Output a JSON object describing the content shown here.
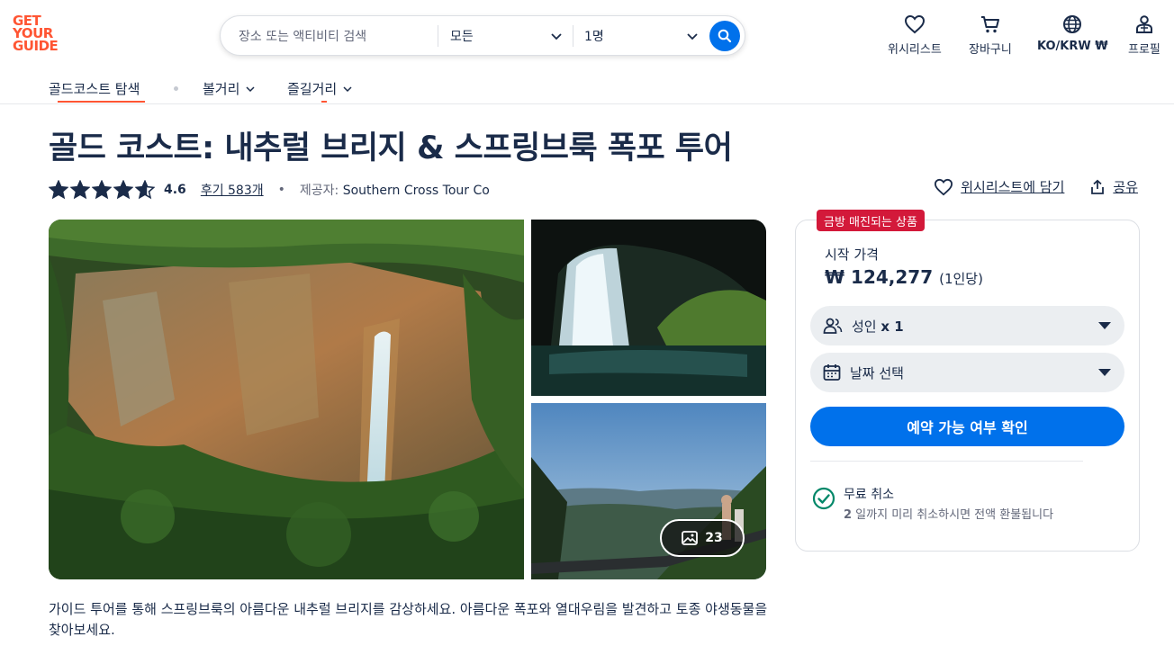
{
  "header": {
    "logo": [
      "GET",
      "YOUR",
      "GUIDE"
    ],
    "search": {
      "placeholder": "장소 또는 액티비티 검색",
      "date_value": "모든",
      "people_value": "1명"
    },
    "nav": {
      "wishlist": "위시리스트",
      "cart": "장바구니",
      "locale": "KO/KRW ₩",
      "profile": "프로필"
    }
  },
  "subnav": {
    "explore": "골드코스트 탐색",
    "sights": "볼거리",
    "activities": "즐길거리"
  },
  "product": {
    "title": "골드 코스트: 내추럴 브리지 & 스프링브룩 폭포 투어",
    "rating": "4.6",
    "rating_value": 4.6,
    "reviews": "후기 583개",
    "provider_label": "제공자:",
    "provider": "Southern Cross Tour Co",
    "wishlist_action": "위시리스트에 담기",
    "share_action": "공유",
    "photo_count": "23",
    "description": "가이드 투어를 통해 스프링브룩의 아름다운 내추럴 브리지를 감상하세요. 아름다운 폭포와 열대우림을 발견하고 토종 야생동물을 찾아보세요."
  },
  "booking": {
    "badge": "금방 매진되는 상품",
    "price_label": "시작 가격",
    "price": "₩ 124,277",
    "price_per": "(1인당)",
    "participants_label": "성인",
    "participants_count": "x 1",
    "date_label": "날짜 선택",
    "cta": "예약 가능 여부 확인",
    "cancel_title": "무료 취소",
    "cancel_days": "2",
    "cancel_text": " 일까지 미리 취소하시면 전액 환불됩니다"
  },
  "colors": {
    "brand": "#ff5533",
    "primary": "#0071eb",
    "text": "#1a2b49",
    "badge": "#d3193a",
    "success": "#008768"
  }
}
